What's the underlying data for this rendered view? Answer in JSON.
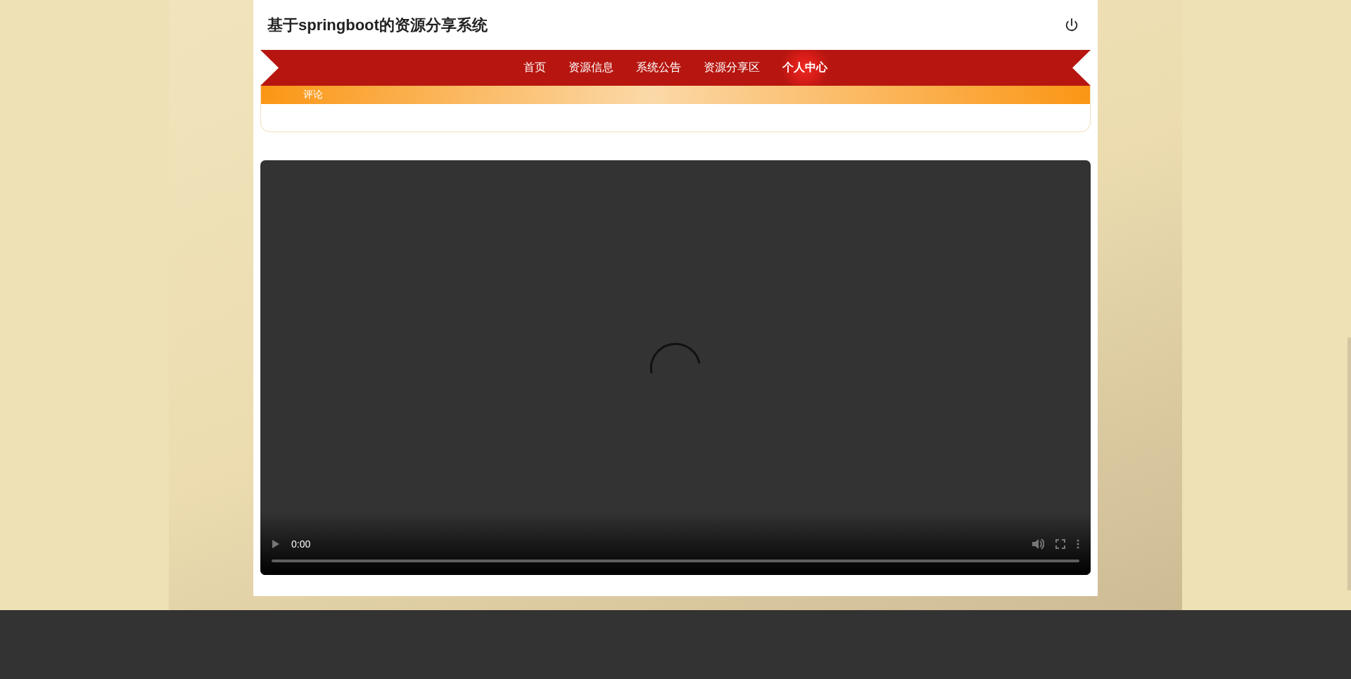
{
  "header": {
    "title": "基于springboot的资源分享系统"
  },
  "nav": {
    "items": [
      {
        "label": "首页",
        "selected": false
      },
      {
        "label": "资源信息",
        "selected": false
      },
      {
        "label": "系统公告",
        "selected": false
      },
      {
        "label": "资源分享区",
        "selected": false
      },
      {
        "label": "个人中心",
        "selected": true
      }
    ]
  },
  "comment_bar": {
    "label": "评论"
  },
  "video": {
    "time": "0:00",
    "loading": true
  }
}
